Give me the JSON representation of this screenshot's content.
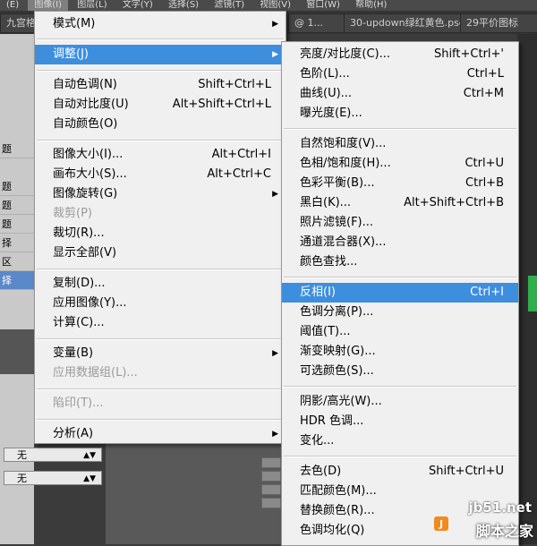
{
  "background": {
    "menubar": [
      "(E)",
      "图像(I)",
      "图层(L)",
      "文字(Y)",
      "选择(S)",
      "滤镜(T)",
      "视图(V)",
      "窗口(W)",
      "帮助(H)"
    ],
    "tabs": [
      "九宫格",
      "@ 1...",
      "30-updown绿红黄色.psd",
      "29平价图标"
    ],
    "left_rows": [
      "题",
      "题",
      "题",
      "题",
      "择",
      "区",
      "择"
    ],
    "field_value_1": "无",
    "field_value_2": "无"
  },
  "image_menu": {
    "items": [
      {
        "label": "模式(M)",
        "shortcut": "",
        "submenu": true,
        "disabled": false
      },
      {
        "label": "调整(J)",
        "shortcut": "",
        "submenu": true,
        "disabled": false,
        "highlighted": true
      },
      {
        "label": "自动色调(N)",
        "shortcut": "Shift+Ctrl+L",
        "submenu": false,
        "disabled": false
      },
      {
        "label": "自动对比度(U)",
        "shortcut": "Alt+Shift+Ctrl+L",
        "submenu": false,
        "disabled": false
      },
      {
        "label": "自动颜色(O)",
        "shortcut": "",
        "submenu": false,
        "disabled": false
      },
      {
        "label": "图像大小(I)...",
        "shortcut": "Alt+Ctrl+I",
        "submenu": false,
        "disabled": false
      },
      {
        "label": "画布大小(S)...",
        "shortcut": "Alt+Ctrl+C",
        "submenu": false,
        "disabled": false
      },
      {
        "label": "图像旋转(G)",
        "shortcut": "",
        "submenu": true,
        "disabled": false
      },
      {
        "label": "裁剪(P)",
        "shortcut": "",
        "submenu": false,
        "disabled": true
      },
      {
        "label": "裁切(R)...",
        "shortcut": "",
        "submenu": false,
        "disabled": false
      },
      {
        "label": "显示全部(V)",
        "shortcut": "",
        "submenu": false,
        "disabled": false
      },
      {
        "label": "复制(D)...",
        "shortcut": "",
        "submenu": false,
        "disabled": false
      },
      {
        "label": "应用图像(Y)...",
        "shortcut": "",
        "submenu": false,
        "disabled": false
      },
      {
        "label": "计算(C)...",
        "shortcut": "",
        "submenu": false,
        "disabled": false
      },
      {
        "label": "变量(B)",
        "shortcut": "",
        "submenu": true,
        "disabled": false
      },
      {
        "label": "应用数据组(L)...",
        "shortcut": "",
        "submenu": false,
        "disabled": true
      },
      {
        "label": "陷印(T)...",
        "shortcut": "",
        "submenu": false,
        "disabled": true
      },
      {
        "label": "分析(A)",
        "shortcut": "",
        "submenu": true,
        "disabled": false
      }
    ]
  },
  "adjust_menu": {
    "items": [
      {
        "label": "亮度/对比度(C)...",
        "shortcut": "Shift+Ctrl+'"
      },
      {
        "label": "色阶(L)...",
        "shortcut": "Ctrl+L"
      },
      {
        "label": "曲线(U)...",
        "shortcut": "Ctrl+M"
      },
      {
        "label": "曝光度(E)...",
        "shortcut": ""
      },
      {
        "label": "自然饱和度(V)...",
        "shortcut": ""
      },
      {
        "label": "色相/饱和度(H)...",
        "shortcut": "Ctrl+U"
      },
      {
        "label": "色彩平衡(B)...",
        "shortcut": "Ctrl+B"
      },
      {
        "label": "黑白(K)...",
        "shortcut": "Alt+Shift+Ctrl+B"
      },
      {
        "label": "照片滤镜(F)...",
        "shortcut": ""
      },
      {
        "label": "通道混合器(X)...",
        "shortcut": ""
      },
      {
        "label": "颜色查找...",
        "shortcut": ""
      },
      {
        "label": "反相(I)",
        "shortcut": "Ctrl+I",
        "highlighted": true
      },
      {
        "label": "色调分离(P)...",
        "shortcut": ""
      },
      {
        "label": "阈值(T)...",
        "shortcut": ""
      },
      {
        "label": "渐变映射(G)...",
        "shortcut": ""
      },
      {
        "label": "可选颜色(S)...",
        "shortcut": ""
      },
      {
        "label": "阴影/高光(W)...",
        "shortcut": ""
      },
      {
        "label": "HDR 色调...",
        "shortcut": ""
      },
      {
        "label": "变化...",
        "shortcut": ""
      },
      {
        "label": "去色(D)",
        "shortcut": "Shift+Ctrl+U"
      },
      {
        "label": "匹配颜色(M)...",
        "shortcut": ""
      },
      {
        "label": "替换颜色(R)...",
        "shortcut": ""
      },
      {
        "label": "色调均化(Q)",
        "shortcut": ""
      }
    ]
  },
  "watermark": {
    "url": "jb51.net",
    "name": "脚本之家"
  },
  "colors": {
    "highlight": "#3e8ede",
    "menu_bg": "#f0f0f0",
    "disabled": "#9a9a9a"
  }
}
